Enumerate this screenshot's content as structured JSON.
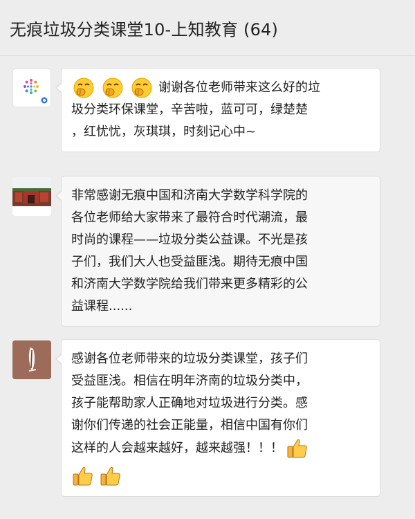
{
  "header": {
    "title": "无痕垃圾分类课堂10-上知教育 (64)"
  },
  "messages": [
    {
      "avatar_icon": "colorful-flower-logo-icon",
      "emojis_lead": [
        "hush-face-emoji",
        "hush-face-emoji",
        "hush-face-emoji"
      ],
      "lines": [
        "谢谢各位老师带来这么好的垃",
        "圾分类环保课堂，辛苦啦，蓝可可，绿楚楚",
        "，红忧忧，灰琪琪，时刻记心中~"
      ]
    },
    {
      "avatar_icon": "red-gate-photo-avatar",
      "lines": [
        "非常感谢无痕中国和济南大学数学科学院的",
        "各位老师给大家带来了最符合时代潮流，最",
        "时尚的课程——垃圾分类公益课。不光是孩",
        "子们，我们大人也受益匪浅。期待无痕中国",
        "和济南大学数学院给我们带来更多精彩的公",
        "益课程......"
      ]
    },
    {
      "avatar_icon": "brown-sketch-avatar",
      "lines": [
        "感谢各位老师带来的垃圾分类课堂，孩子们",
        "受益匪浅。相信在明年济南的垃圾分类中，",
        "孩子能帮助家人正确地对垃圾进行分类。感",
        "谢你们传递的社会正能量，相信中国有你们",
        "这样的人会越来越好，越来越强！！！"
      ],
      "emojis_tail": [
        "thumbs-up-emoji",
        "thumbs-up-emoji",
        "thumbs-up-emoji"
      ]
    }
  ]
}
